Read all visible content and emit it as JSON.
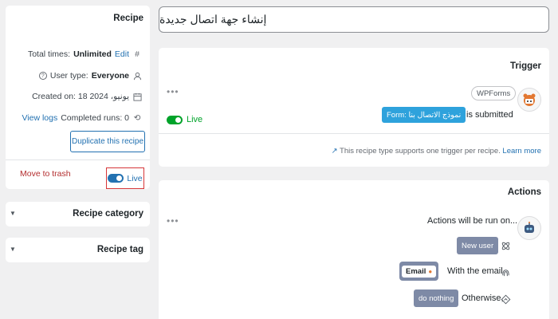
{
  "recipe": {
    "title": "Recipe",
    "total_times_label": "Total times:",
    "total_times_value": "Unlimited",
    "edit_link": "Edit",
    "user_type_label": "User type:",
    "user_type_value": "Everyone",
    "created_on": "Created on: 18 يونيو، 2024",
    "completed_runs": "Completed runs: 0",
    "view_logs": "View logs",
    "duplicate_button": "Duplicate this recipe",
    "move_to_trash": "Move to trash",
    "live_label": "Live"
  },
  "sidebar_sections": {
    "category": "Recipe category",
    "tag": "Recipe tag"
  },
  "title_input": {
    "value": "إنشاء جهة اتصال جديدة"
  },
  "trigger": {
    "heading": "Trigger",
    "integration": "WPForms",
    "form_chip": "Form: نموذج الاتصال بنا",
    "suffix": "is submitted",
    "status": "Live",
    "note": "This recipe type supports one trigger per recipe.",
    "learn_more": "Learn more"
  },
  "actions": {
    "heading": "Actions",
    "run_on": "Actions will be run on...",
    "new_user": "New user",
    "with_email": "With the email",
    "email_token": "Email",
    "otherwise": "Otherwise,",
    "do_nothing": "do nothing"
  },
  "colors": {
    "accent": "#2271b1",
    "live_green": "#00a32a",
    "trash_red": "#b32d2e",
    "chip_blue": "#2ea2dc",
    "chip_gray": "#7e8aa6"
  }
}
